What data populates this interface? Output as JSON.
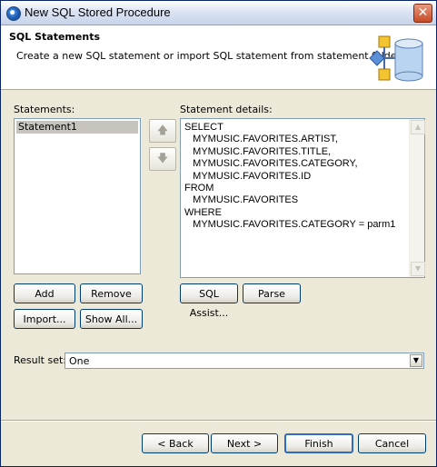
{
  "window": {
    "title": "New SQL Stored Procedure"
  },
  "banner": {
    "heading": "SQL Statements",
    "description": "Create a new SQL statement or import SQL statement from statement folder."
  },
  "statements": {
    "label": "Statements:",
    "items": [
      "Statement1"
    ],
    "selected": "Statement1"
  },
  "details": {
    "label": "Statement details:",
    "sql": "SELECT\n   MYMUSIC.FAVORITES.ARTIST,\n   MYMUSIC.FAVORITES.TITLE,\n   MYMUSIC.FAVORITES.CATEGORY,\n   MYMUSIC.FAVORITES.ID\nFROM\n   MYMUSIC.FAVORITES\nWHERE\n   MYMUSIC.FAVORITES.CATEGORY = parm1"
  },
  "buttons": {
    "add": "Add",
    "remove": "Remove",
    "import": "Import...",
    "show_all": "Show All...",
    "sql_assist": "SQL Assist...",
    "parse": "Parse",
    "back": "< Back",
    "next": "Next >",
    "finish": "Finish",
    "cancel": "Cancel"
  },
  "result_set": {
    "label": "Result set:",
    "value": "One"
  },
  "icons": {
    "move_up": "arrow-up-icon",
    "move_down": "arrow-down-icon",
    "close": "close-icon",
    "banner": "database-wizard-icon"
  }
}
